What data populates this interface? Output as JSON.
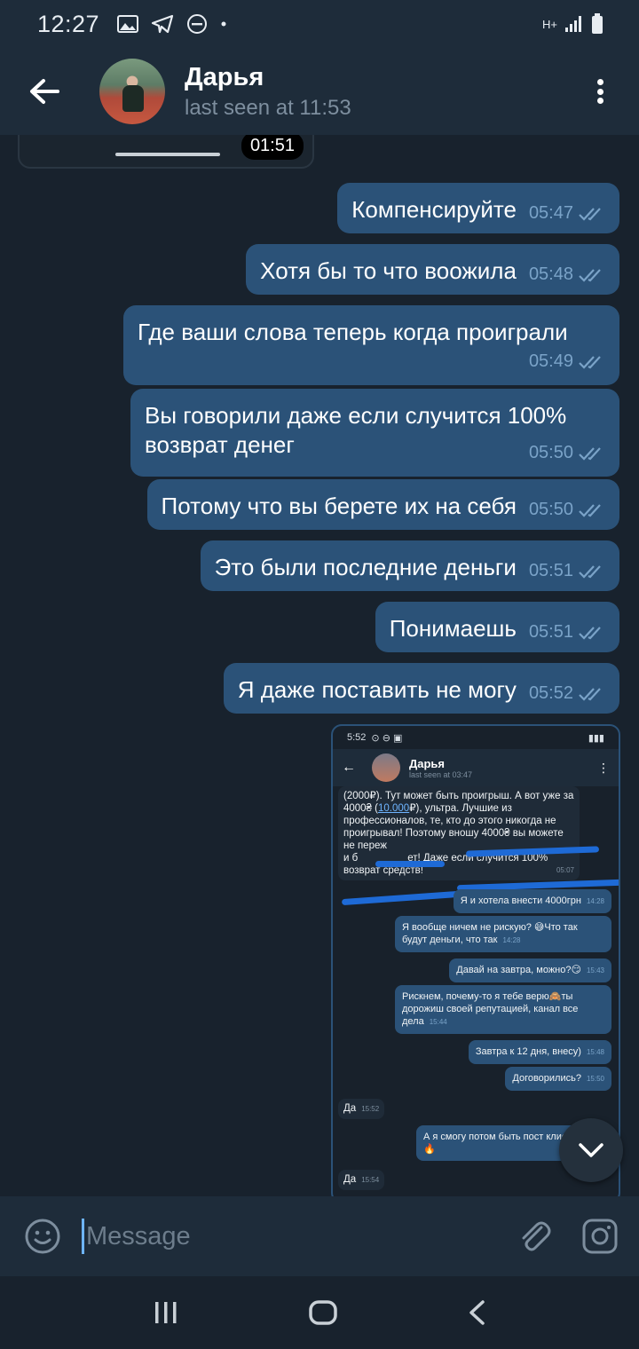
{
  "status_bar": {
    "time": "12:27",
    "network": "H+"
  },
  "header": {
    "name": "Дарья",
    "status": "last seen at 11:53"
  },
  "video": {
    "duration": "01:51"
  },
  "messages": [
    {
      "text": "Компенсируйте",
      "time": "05:47"
    },
    {
      "text": "Хотя бы то что воожила",
      "time": "05:48"
    },
    {
      "text": "Где ваши слова теперь когда проиграли",
      "time": "05:49"
    },
    {
      "text": "Вы говорили даже если случится 100% возврат денег",
      "time": "05:50"
    },
    {
      "text": "Потому что вы берете их на себя",
      "time": "05:50"
    },
    {
      "text": "Это были последние деньги",
      "time": "05:51"
    },
    {
      "text": "Понимаешь",
      "time": "05:51"
    },
    {
      "text": "Я даже поставить не могу",
      "time": "05:52"
    }
  ],
  "screenshot": {
    "status_time": "5:52",
    "name": "Дарья",
    "status": "last seen at 03:47",
    "incoming_text_1": "(2000₽). Тут может быть проигрыш. А вот уже за 4000₴ (",
    "incoming_link": "10.000",
    "incoming_text_2": "₽), ультра. Лучшие из профессионалов, те, кто до этого никогда не проигрывал!  Поэтому вношу 4000₴ вы можете не переж",
    "incoming_text_3": "и б",
    "incoming_text_4": "ет! Даже если случится 100% возврат средств!",
    "incoming_time": "05:07",
    "bubbles": [
      {
        "text": "Я и хотела внести 4000грн",
        "time": "14:28"
      },
      {
        "text": "Я вообще ничем не рискую? 😅Что так будут деньги, что так",
        "time": "14:28"
      },
      {
        "text": "Давай на завтра, можно?😏",
        "time": "15:43"
      },
      {
        "text": "Рискнем, почему-то я тебе верю🙈ты дорожиш своей репутацией, канал все дела",
        "time": "15:44"
      },
      {
        "text": "Завтра к 12 дня, внесу)",
        "time": "15:48"
      },
      {
        "text": "Договорились?",
        "time": "15:50"
      },
      {
        "text": "Да",
        "time": "15:52"
      },
      {
        "text": "А я смогу потом быть пост клиентом?🔥",
        "time": ""
      },
      {
        "text": "Да",
        "time": "15:54"
      }
    ]
  },
  "composer": {
    "placeholder": "Message"
  },
  "colors": {
    "bubble_out": "#2b5278",
    "background": "#18222d",
    "header": "#1e2c3a",
    "check": "#7aa3c8"
  }
}
